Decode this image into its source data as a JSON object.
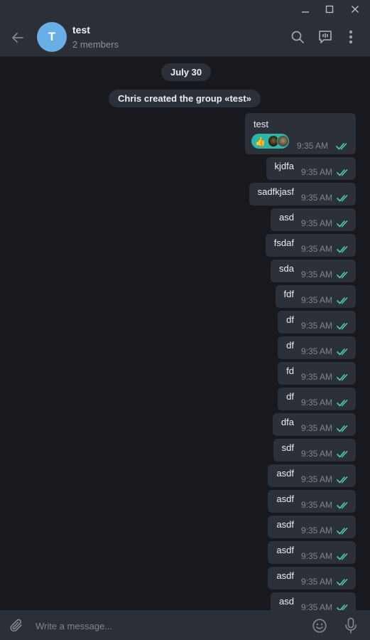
{
  "window": {
    "controls": [
      "minimize",
      "maximize",
      "close"
    ]
  },
  "header": {
    "avatar_letter": "T",
    "avatar_color": "#6aaee6",
    "title": "test",
    "subtitle": "2 members",
    "icons": [
      "back-arrow-icon",
      "search-icon",
      "discussion-icon",
      "more-vertical-icon"
    ]
  },
  "chat": {
    "date_label": "July 30",
    "service_message": "Chris created the group «test»",
    "first_message": {
      "text": "test",
      "time": "9:35 AM",
      "reaction_emoji": "👍"
    },
    "messages": [
      {
        "text": "kjdfa",
        "time": "9:35 AM"
      },
      {
        "text": "sadfkjasf",
        "time": "9:35 AM"
      },
      {
        "text": "asd",
        "time": "9:35 AM"
      },
      {
        "text": "fsdaf",
        "time": "9:35 AM"
      },
      {
        "text": "sda",
        "time": "9:35 AM"
      },
      {
        "text": "fdf",
        "time": "9:35 AM"
      },
      {
        "text": "df",
        "time": "9:35 AM"
      },
      {
        "text": "df",
        "time": "9:35 AM"
      },
      {
        "text": "fd",
        "time": "9:35 AM"
      },
      {
        "text": "df",
        "time": "9:35 AM"
      },
      {
        "text": "dfa",
        "time": "9:35 AM"
      },
      {
        "text": "sdf",
        "time": "9:35 AM"
      },
      {
        "text": "asdf",
        "time": "9:35 AM"
      },
      {
        "text": "asdf",
        "time": "9:35 AM"
      },
      {
        "text": "asdf",
        "time": "9:35 AM"
      },
      {
        "text": "asdf",
        "time": "9:35 AM"
      },
      {
        "text": "asdf",
        "time": "9:35 AM"
      },
      {
        "text": "asd",
        "time": "9:35 AM"
      }
    ],
    "read_check_color": "#4ecfa5"
  },
  "composer": {
    "placeholder": "Write a message...",
    "value": ""
  },
  "colors": {
    "background": "#17191e",
    "panel": "#2b2f37",
    "bubble": "#2c3139",
    "accent": "#2fb5a8"
  }
}
